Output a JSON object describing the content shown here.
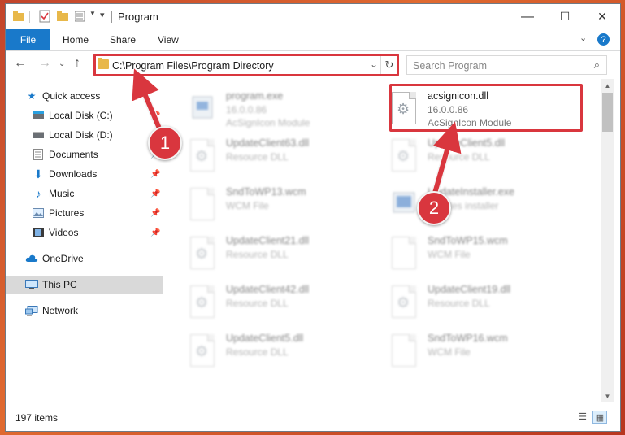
{
  "window": {
    "title": "Program",
    "controls": {
      "minimize": "—",
      "maximize": "☐",
      "close": "✕"
    }
  },
  "ribbon": {
    "file_tab": "File",
    "tabs": [
      "Home",
      "Share",
      "View"
    ]
  },
  "nav": {
    "address": "C:\\Program Files\\Program Directory",
    "search_placeholder": "Search Program"
  },
  "sidebar": {
    "items": [
      {
        "label": "Quick access",
        "icon": "star-icon",
        "pinned": false
      },
      {
        "label": "Local Disk (C:)",
        "icon": "drive-icon",
        "pinned": true
      },
      {
        "label": "Local Disk (D:)",
        "icon": "drive-icon",
        "pinned": false
      },
      {
        "label": "Documents",
        "icon": "document-icon",
        "pinned": true
      },
      {
        "label": "Downloads",
        "icon": "download-icon",
        "pinned": true
      },
      {
        "label": "Music",
        "icon": "music-icon",
        "pinned": true
      },
      {
        "label": "Pictures",
        "icon": "pictures-icon",
        "pinned": true
      },
      {
        "label": "Videos",
        "icon": "video-icon",
        "pinned": true
      },
      {
        "label": "OneDrive",
        "icon": "cloud-icon",
        "pinned": false
      },
      {
        "label": "This PC",
        "icon": "computer-icon",
        "pinned": false,
        "selected": true
      },
      {
        "label": "Network",
        "icon": "network-icon",
        "pinned": false
      }
    ]
  },
  "files": [
    {
      "name": "program.exe",
      "version": "16.0.0.86",
      "type": "AcSignIcon Module",
      "blurred": true
    },
    {
      "name": "acsignicon.dll",
      "version": "16.0.0.86",
      "type": "AcSignIcon Module",
      "blurred": false
    },
    {
      "name": "UpdateClient63.dll",
      "type": "Resource DLL",
      "blurred": true
    },
    {
      "name": "UpdateClient5.dll",
      "type": "Resource DLL",
      "blurred": true
    },
    {
      "name": "SndToWP13.wcm",
      "type": "WCM File",
      "blurred": true
    },
    {
      "name": "UpdateInstaller.exe",
      "type": "updates installer",
      "blurred": true
    },
    {
      "name": "UpdateClient21.dll",
      "type": "Resource DLL",
      "blurred": true
    },
    {
      "name": "SndToWP15.wcm",
      "type": "WCM File",
      "blurred": true
    },
    {
      "name": "UpdateClient42.dll",
      "type": "Resource DLL",
      "blurred": true
    },
    {
      "name": "UpdateClient19.dll",
      "type": "Resource DLL",
      "blurred": true
    },
    {
      "name": "UpdateClient5.dll",
      "type": "Resource DLL",
      "blurred": true
    },
    {
      "name": "SndToWP16.wcm",
      "type": "WCM File",
      "blurred": true
    }
  ],
  "status": {
    "item_count": "197 items"
  },
  "annotations": {
    "step1": "1",
    "step2": "2",
    "color": "#d9363e"
  }
}
